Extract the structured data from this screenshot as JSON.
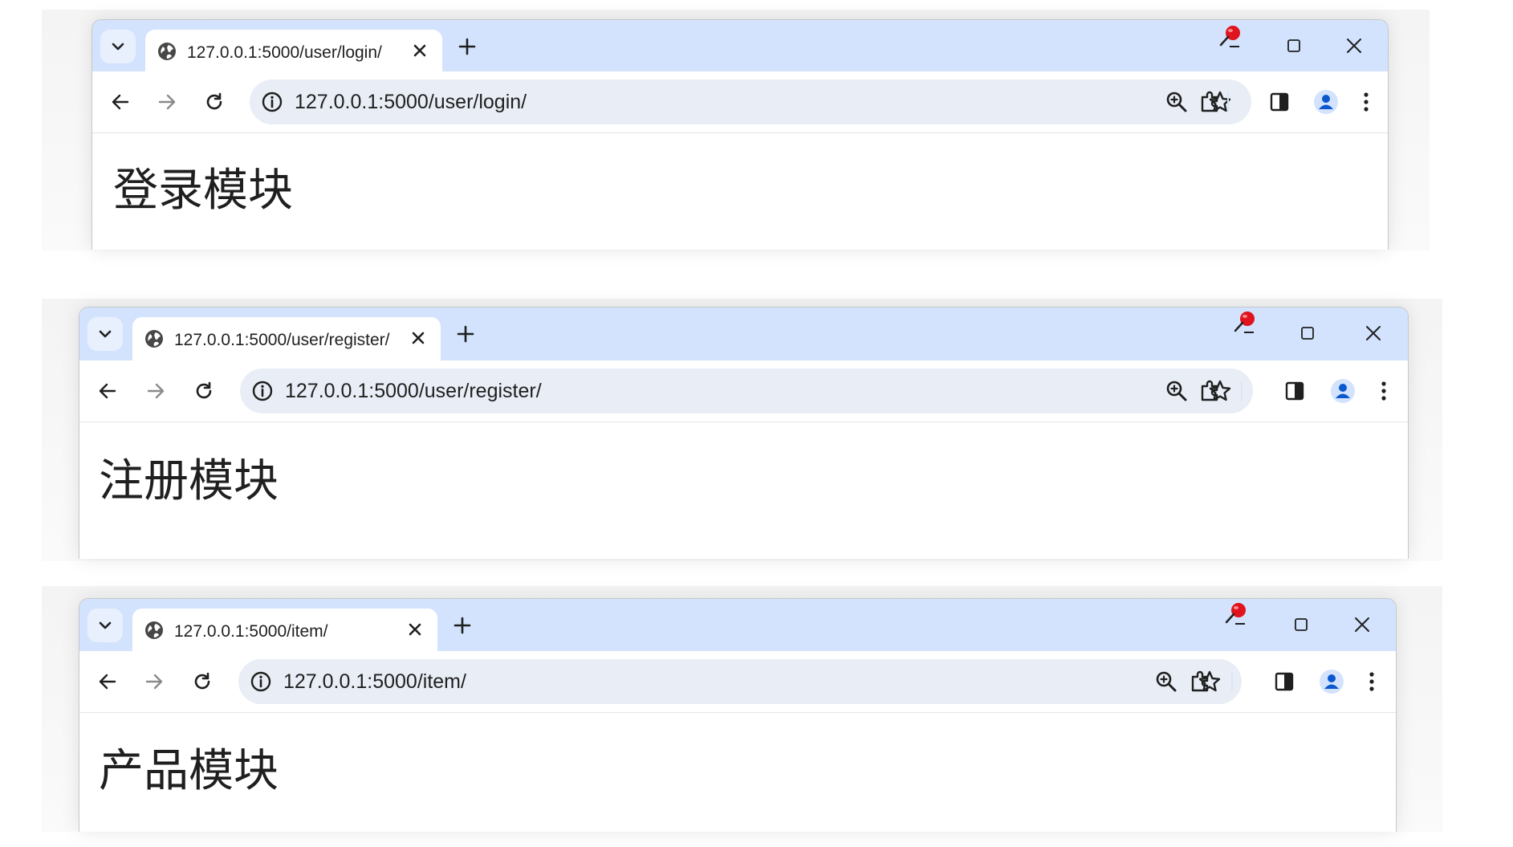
{
  "windows": [
    {
      "tab_title": "127.0.0.1:5000/user/login/",
      "url": "127.0.0.1:5000/user/login/",
      "heading": "登录模块"
    },
    {
      "tab_title": "127.0.0.1:5000/user/register/",
      "url": "127.0.0.1:5000/user/register/",
      "heading": "注册模块"
    },
    {
      "tab_title": "127.0.0.1:5000/item/",
      "url": "127.0.0.1:5000/item/",
      "heading": "产品模块"
    }
  ],
  "icons": {
    "tab_menu": "chevron-down-icon",
    "favicon": "globe-icon",
    "tab_close": "close-icon",
    "new_tab": "plus-icon",
    "pin": "red-pushpin-icon",
    "maximize": "maximize-icon",
    "window_close": "close-icon",
    "back": "arrow-left-icon",
    "forward": "arrow-right-icon",
    "reload": "reload-icon",
    "site_info": "info-icon",
    "zoom": "zoom-in-icon",
    "bookmark": "star-icon",
    "extensions": "puzzle-icon",
    "side_panel": "side-panel-icon",
    "profile": "person-icon",
    "menu": "more-vert-icon"
  },
  "colors": {
    "tabstrip": "#d3e3fd",
    "omnibox": "#e9eef6",
    "profile_accent": "#0b57d0",
    "pin_red": "#e0141e"
  }
}
